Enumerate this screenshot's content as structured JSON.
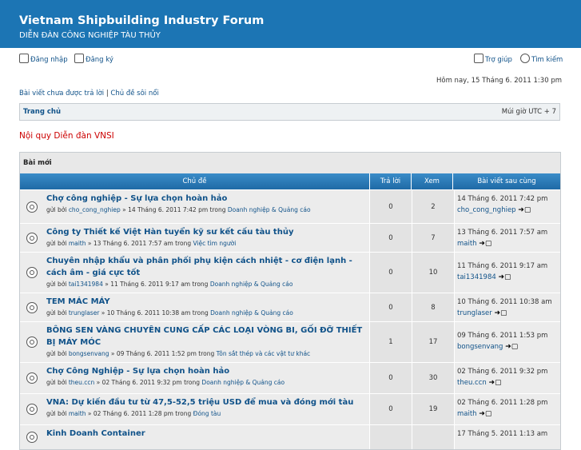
{
  "header": {
    "title": "Vietnam Shipbuilding Industry Forum",
    "subtitle": "DIỄN ĐÀN CÔNG NGHIỆP TÀU THỦY"
  },
  "userbar": {
    "login": "Đăng nhập",
    "register": "Đăng ký",
    "help": "Trợ giúp",
    "search": "Tìm kiếm"
  },
  "date": "Hôm nay, 15 Tháng 6. 2011 1:30 pm",
  "links": {
    "unanswered": "Bài viết chưa được trả lời",
    "sep": " | ",
    "active": "Chủ đề sôi nổi"
  },
  "navbar": {
    "home": "Trang chủ",
    "timezone": "Múi giờ UTC + 7"
  },
  "rules": "Nội quy Diễn đàn VNSI",
  "section": "Bài mới",
  "columns": {
    "topic": "Chủ đề",
    "replies": "Trả lời",
    "views": "Xem",
    "last": "Bài viết sau cùng"
  },
  "topics": [
    {
      "title": "Chợ công nghiệp - Sự lựa chọn hoàn hảo",
      "by": "gửi bởi",
      "author": "cho_cong_nghiep",
      "meta": " » 14 Tháng 6. 2011 7:42 pm trong ",
      "forum": "Doanh nghiệp & Quảng cáo",
      "replies": "0",
      "views": "2",
      "last_date": "14 Tháng 6. 2011 7:42 pm",
      "last_user": "cho_cong_nghiep"
    },
    {
      "title": "Công ty Thiết kế Việt Hàn tuyển kỹ sư kết cấu tàu thủy",
      "by": "gửi bởi",
      "author": "maith",
      "meta": " » 13 Tháng 6. 2011 7:57 am trong ",
      "forum": "Việc tìm người",
      "replies": "0",
      "views": "7",
      "last_date": "13 Tháng 6. 2011 7:57 am",
      "last_user": "maith"
    },
    {
      "title": "Chuyên nhập khẩu và phân phối phụ kiện cách nhiệt - cơ điện lạnh - cách âm - giá cực tốt",
      "by": "gửi bởi",
      "author": "tai1341984",
      "meta": " » 11 Tháng 6. 2011 9:17 am trong ",
      "forum": "Doanh nghiệp & Quảng cáo",
      "replies": "0",
      "views": "10",
      "last_date": "11 Tháng 6. 2011 9:17 am",
      "last_user": "tai1341984"
    },
    {
      "title": "TEM MÁC MÁY",
      "by": "gửi bởi",
      "author": "trunglaser",
      "meta": " » 10 Tháng 6. 2011 10:38 am trong ",
      "forum": "Doanh nghiệp & Quảng cáo",
      "replies": "0",
      "views": "8",
      "last_date": "10 Tháng 6. 2011 10:38 am",
      "last_user": "trunglaser"
    },
    {
      "title": "BÔNG SEN VÀNG CHUYÊN CUNG CẤP CÁC LOẠI VÒNG BI, GỐI ĐỠ THIẾT BỊ MÁY MÓC",
      "by": "gửi bởi",
      "author": "bongsenvang",
      "meta": " » 09 Tháng 6. 2011 1:52 pm trong ",
      "forum": "Tôn sắt thép và các vật tư khác",
      "replies": "1",
      "views": "17",
      "last_date": "09 Tháng 6. 2011 1:53 pm",
      "last_user": "bongsenvang"
    },
    {
      "title": "Chợ Công Nghiệp - Sự lựa chọn hoàn hảo",
      "by": "gửi bởi",
      "author": "theu.ccn",
      "meta": " » 02 Tháng 6. 2011 9:32 pm trong ",
      "forum": "Doanh nghiệp & Quảng cáo",
      "replies": "0",
      "views": "30",
      "last_date": "02 Tháng 6. 2011 9:32 pm",
      "last_user": "theu.ccn"
    },
    {
      "title": "VNA: Dự kiến đầu tư từ 47,5-52,5 triệu USD để mua và đóng mới tàu",
      "by": "gửi bởi",
      "author": "maith",
      "meta": " » 02 Tháng 6. 2011 1:28 pm trong ",
      "forum": "Đóng tàu",
      "replies": "0",
      "views": "19",
      "last_date": "02 Tháng 6. 2011 1:28 pm",
      "last_user": "maith"
    },
    {
      "title": "Kinh Doanh Container",
      "by": "",
      "author": "",
      "meta": "",
      "forum": "",
      "replies": "",
      "views": "",
      "last_date": "17 Tháng 5. 2011 1:13 am",
      "last_user": ""
    }
  ]
}
